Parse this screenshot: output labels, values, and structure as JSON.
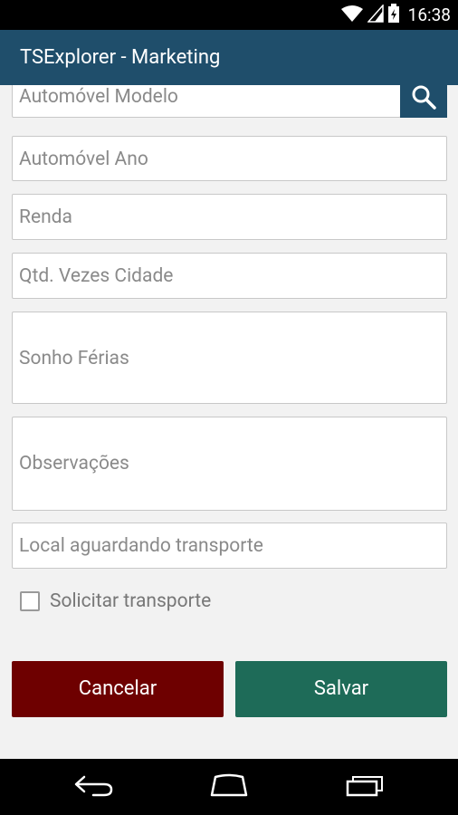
{
  "status_bar": {
    "time": "16:38",
    "icons": [
      "wifi-icon",
      "signal-icon",
      "battery-icon"
    ]
  },
  "app_bar": {
    "title": "TSExplorer - Marketing"
  },
  "form": {
    "modelo_placeholder": "Automóvel Modelo",
    "ano_placeholder": "Automóvel Ano",
    "renda_placeholder": "Renda",
    "vezes_placeholder": "Qtd. Vezes Cidade",
    "ferias_placeholder": "Sonho Férias",
    "observacoes_placeholder": "Observações",
    "local_placeholder": "Local aguardando transporte",
    "transporte_checkbox_label": "Solicitar transporte",
    "transporte_checked": false
  },
  "buttons": {
    "cancel_label": "Cancelar",
    "save_label": "Salvar"
  },
  "colors": {
    "app_bar": "#1f4e6b",
    "cancel": "#6e0000",
    "save": "#1e6b58"
  },
  "nav_bar": {
    "icons": [
      "back-icon",
      "home-icon",
      "recent-apps-icon"
    ]
  }
}
